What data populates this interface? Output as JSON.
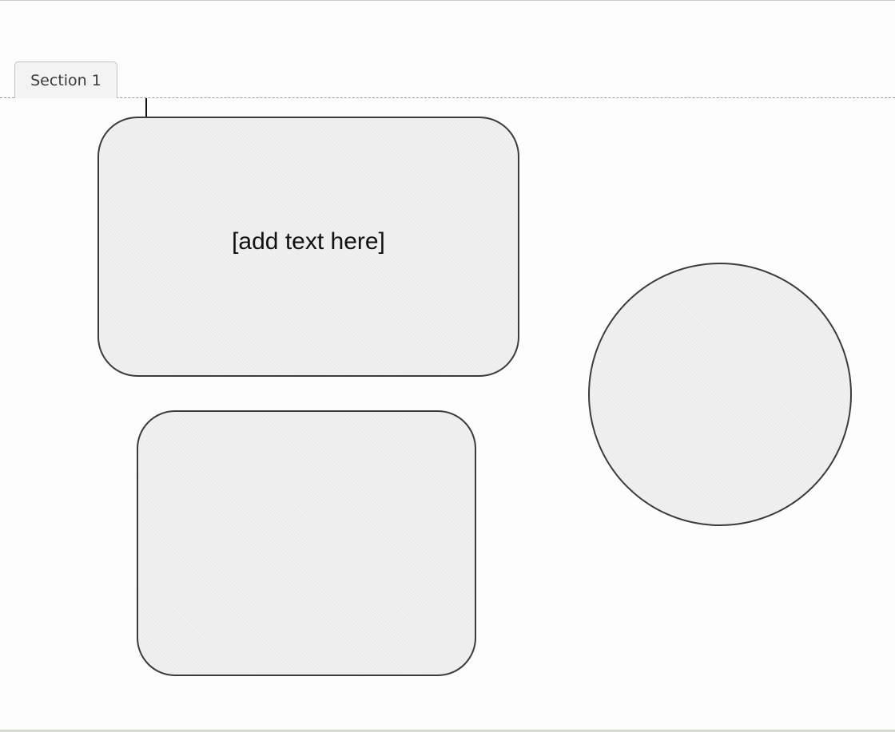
{
  "section": {
    "tab_label": "Section 1"
  },
  "shapes": {
    "rounded_rect_1": {
      "text": "[add text here]"
    }
  },
  "colors": {
    "shape_fill": "#ececec",
    "shape_stroke": "#3b3b3b",
    "canvas_background": "#fdfdfd",
    "divider": "#9c9c9c"
  }
}
